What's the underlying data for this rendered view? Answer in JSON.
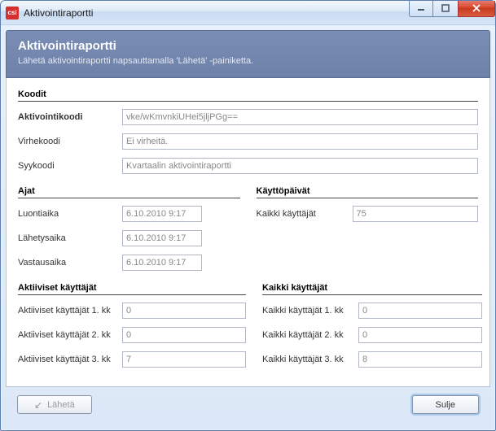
{
  "window": {
    "title": "Aktivointiraportti",
    "icon_text": "csi"
  },
  "header": {
    "title": "Aktivointiraportti",
    "subtitle": "Lähetä aktivointiraportti napsauttamalla 'Lähetä' -painiketta."
  },
  "sections": {
    "codes_h": "Koodit",
    "times_h": "Ajat",
    "usagedays_h": "Käyttöpäivät",
    "activeusers_h": "Aktiiviset käyttäjät",
    "allusers_h": "Kaikki käyttäjät"
  },
  "codes": {
    "activation_label": "Aktivointikoodi",
    "activation_value": "vke/wKmvnkiUHei5jljPGg==",
    "error_label": "Virhekoodi",
    "error_value": "Ei virheitä.",
    "reason_label": "Syykoodi",
    "reason_value": "Kvartaalin aktivointiraportti"
  },
  "times": {
    "created_label": "Luontiaika",
    "created_value": "6.10.2010 9:17",
    "sent_label": "Lähetysaika",
    "sent_value": "6.10.2010 9:17",
    "reply_label": "Vastausaika",
    "reply_value": "6.10.2010 9:17"
  },
  "usagedays": {
    "all_label": "Kaikki käyttäjät",
    "all_value": "75"
  },
  "active": {
    "m1_label": "Aktiiviset käyttäjät 1. kk",
    "m1_value": "0",
    "m2_label": "Aktiiviset käyttäjät  2. kk",
    "m2_value": "0",
    "m3_label": "Aktiiviset käyttäjät  3. kk",
    "m3_value": "7"
  },
  "all": {
    "m1_label": "Kaikki käyttäjät 1. kk",
    "m1_value": "0",
    "m2_label": "Kaikki käyttäjät 2. kk",
    "m2_value": "0",
    "m3_label": "Kaikki käyttäjät 3. kk",
    "m3_value": "8"
  },
  "buttons": {
    "send": "Lähetä",
    "close": "Sulje"
  }
}
